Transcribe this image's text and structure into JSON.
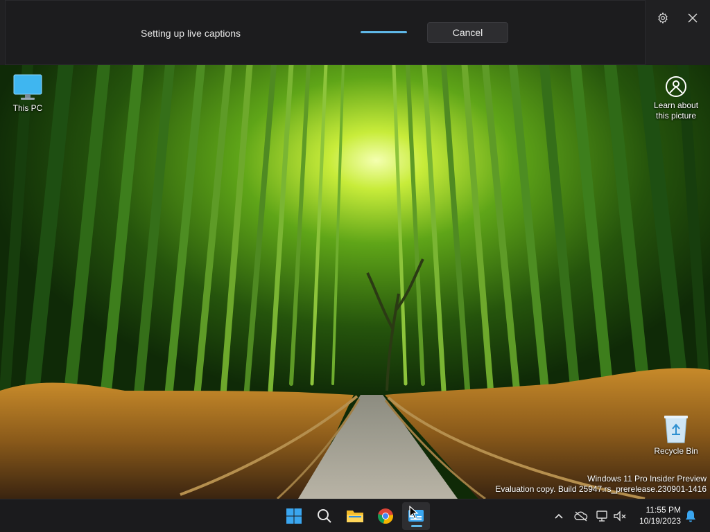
{
  "live_captions": {
    "status_text": "Setting up live captions",
    "cancel_label": "Cancel",
    "settings_icon": "gear-icon",
    "close_icon": "close-icon",
    "progress_color": "#5fb8e8"
  },
  "desktop": {
    "icons": {
      "this_pc": "This PC",
      "learn_about_line1": "Learn about",
      "learn_about_line2": "this picture",
      "recycle_bin": "Recycle Bin"
    },
    "watermark": {
      "line1": "Windows 11 Pro Insider Preview",
      "line2": "Evaluation copy. Build 25947.rs_prerelease.230901-1416"
    }
  },
  "taskbar": {
    "apps": [
      "start-icon",
      "search-icon",
      "file-explorer-icon",
      "chrome-icon",
      "live-captions-icon"
    ],
    "tray": [
      "chevron-up-icon",
      "cloud-offline-icon",
      "network-icon",
      "volume-muted-icon",
      "notification-bell-icon"
    ],
    "clock": {
      "time": "11:55 PM",
      "date": "10/19/2023"
    },
    "accent_color": "#5fb8e8"
  }
}
